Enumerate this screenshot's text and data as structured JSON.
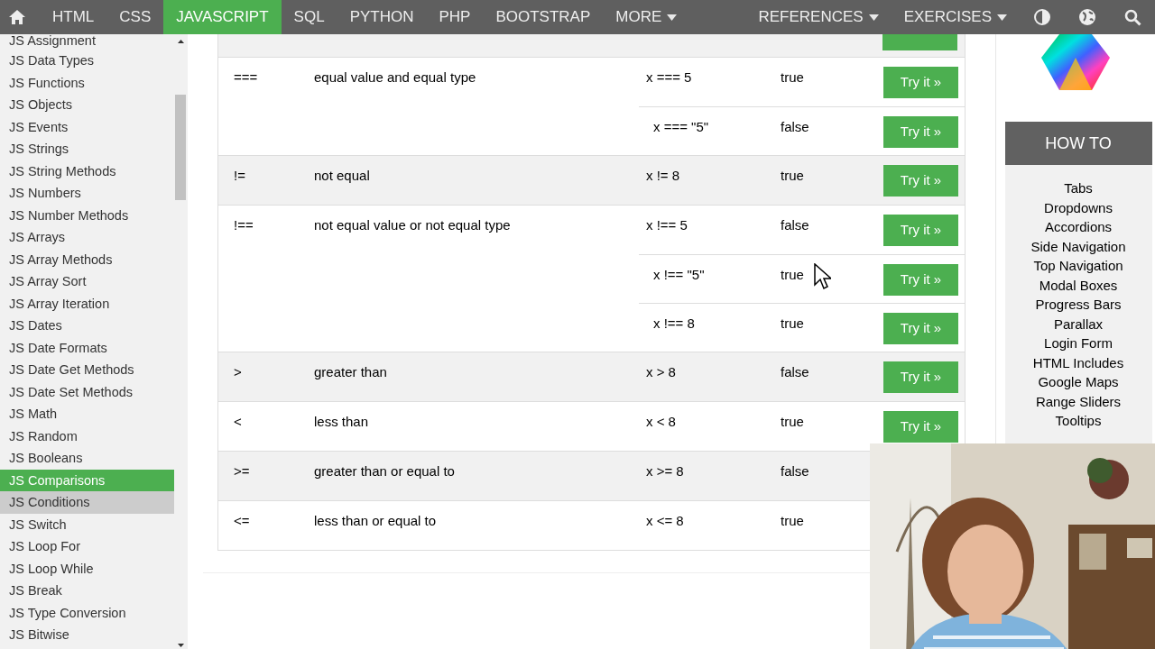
{
  "nav": {
    "items": [
      {
        "label": "HTML",
        "selected": false,
        "dropdown": false
      },
      {
        "label": "CSS",
        "selected": false,
        "dropdown": false
      },
      {
        "label": "JAVASCRIPT",
        "selected": true,
        "dropdown": false
      },
      {
        "label": "SQL",
        "selected": false,
        "dropdown": false
      },
      {
        "label": "PYTHON",
        "selected": false,
        "dropdown": false
      },
      {
        "label": "PHP",
        "selected": false,
        "dropdown": false
      },
      {
        "label": "BOOTSTRAP",
        "selected": false,
        "dropdown": false
      },
      {
        "label": "MORE",
        "selected": false,
        "dropdown": true
      }
    ],
    "right_items": [
      {
        "label": "REFERENCES",
        "dropdown": true
      },
      {
        "label": "EXERCISES",
        "dropdown": true
      }
    ]
  },
  "sidebar": {
    "items": [
      {
        "label": "JS Assignment",
        "selected": false,
        "hovered": false
      },
      {
        "label": "JS Data Types",
        "selected": false,
        "hovered": false
      },
      {
        "label": "JS Functions",
        "selected": false,
        "hovered": false
      },
      {
        "label": "JS Objects",
        "selected": false,
        "hovered": false
      },
      {
        "label": "JS Events",
        "selected": false,
        "hovered": false
      },
      {
        "label": "JS Strings",
        "selected": false,
        "hovered": false
      },
      {
        "label": "JS String Methods",
        "selected": false,
        "hovered": false
      },
      {
        "label": "JS Numbers",
        "selected": false,
        "hovered": false
      },
      {
        "label": "JS Number Methods",
        "selected": false,
        "hovered": false
      },
      {
        "label": "JS Arrays",
        "selected": false,
        "hovered": false
      },
      {
        "label": "JS Array Methods",
        "selected": false,
        "hovered": false
      },
      {
        "label": "JS Array Sort",
        "selected": false,
        "hovered": false
      },
      {
        "label": "JS Array Iteration",
        "selected": false,
        "hovered": false
      },
      {
        "label": "JS Dates",
        "selected": false,
        "hovered": false
      },
      {
        "label": "JS Date Formats",
        "selected": false,
        "hovered": false
      },
      {
        "label": "JS Date Get Methods",
        "selected": false,
        "hovered": false
      },
      {
        "label": "JS Date Set Methods",
        "selected": false,
        "hovered": false
      },
      {
        "label": "JS Math",
        "selected": false,
        "hovered": false
      },
      {
        "label": "JS Random",
        "selected": false,
        "hovered": false
      },
      {
        "label": "JS Booleans",
        "selected": false,
        "hovered": false
      },
      {
        "label": "JS Comparisons",
        "selected": true,
        "hovered": false
      },
      {
        "label": "JS Conditions",
        "selected": false,
        "hovered": true
      },
      {
        "label": "JS Switch",
        "selected": false,
        "hovered": false
      },
      {
        "label": "JS Loop For",
        "selected": false,
        "hovered": false
      },
      {
        "label": "JS Loop While",
        "selected": false,
        "hovered": false
      },
      {
        "label": "JS Break",
        "selected": false,
        "hovered": false
      },
      {
        "label": "JS Type Conversion",
        "selected": false,
        "hovered": false
      },
      {
        "label": "JS Bitwise",
        "selected": false,
        "hovered": false
      }
    ]
  },
  "table": {
    "rows": [
      {
        "operator": "===",
        "description": "equal value and equal type",
        "examples": [
          {
            "code": "x === 5",
            "result": "true",
            "button": "Try it »"
          },
          {
            "code": "x === \"5\"",
            "result": "false",
            "button": "Try it »"
          }
        ]
      },
      {
        "operator": "!=",
        "description": "not equal",
        "examples": [
          {
            "code": "x != 8",
            "result": "true",
            "button": "Try it »"
          }
        ]
      },
      {
        "operator": "!==",
        "description": "not equal value or not equal type",
        "examples": [
          {
            "code": "x !== 5",
            "result": "false",
            "button": "Try it »"
          },
          {
            "code": "x !== \"5\"",
            "result": "true",
            "button": "Try it »"
          },
          {
            "code": "x !== 8",
            "result": "true",
            "button": "Try it »"
          }
        ]
      },
      {
        "operator": ">",
        "description": "greater than",
        "examples": [
          {
            "code": "x > 8",
            "result": "false",
            "button": "Try it »"
          }
        ]
      },
      {
        "operator": "<",
        "description": "less than",
        "examples": [
          {
            "code": "x < 8",
            "result": "true",
            "button": "Try it »"
          }
        ]
      },
      {
        "operator": ">=",
        "description": "greater than or equal to",
        "examples": [
          {
            "code": "x >= 8",
            "result": "false"
          }
        ]
      },
      {
        "operator": "<=",
        "description": "less than or equal to",
        "examples": [
          {
            "code": "x <= 8",
            "result": "true"
          }
        ]
      }
    ]
  },
  "howto": {
    "title": "HOW TO",
    "items": [
      "Tabs",
      "Dropdowns",
      "Accordions",
      "Side Navigation",
      "Top Navigation",
      "Modal Boxes",
      "Progress Bars",
      "Parallax",
      "Login Form",
      "HTML Includes",
      "Google Maps",
      "Range Sliders",
      "Tooltips"
    ]
  }
}
